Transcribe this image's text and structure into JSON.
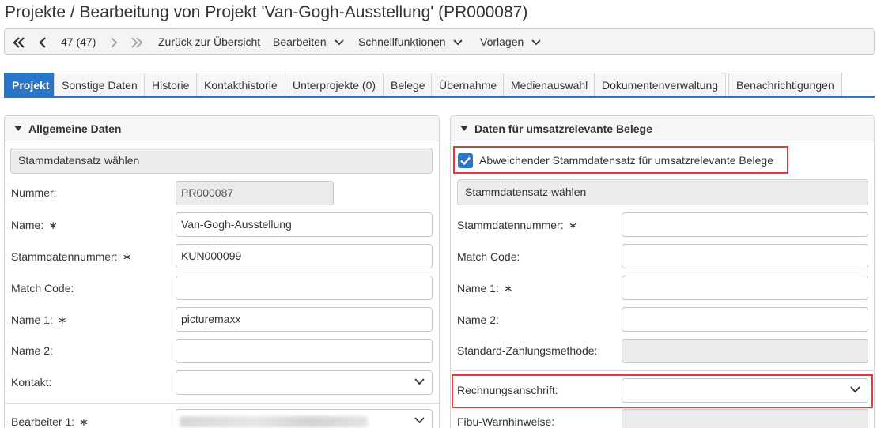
{
  "page": {
    "title": "Projekte / Bearbeitung von Projekt 'Van-Gogh-Ausstellung' (PR000087)"
  },
  "toolbar": {
    "record_counter": "47 (47)",
    "back_to_overview": "Zurück zur Übersicht",
    "edit": "Bearbeiten",
    "quick_functions": "Schnellfunktionen",
    "templates": "Vorlagen"
  },
  "tabs": [
    {
      "label": "Projekt",
      "active": true
    },
    {
      "label": "Sonstige Daten"
    },
    {
      "label": "Historie"
    },
    {
      "label": "Kontakthistorie"
    },
    {
      "label": "Unterprojekte (0)"
    },
    {
      "label": "Belege"
    },
    {
      "label": "Übernahme"
    },
    {
      "label": "Medienauswahl"
    },
    {
      "label": "Dokumentenverwaltung"
    },
    {
      "label": "Benachrichtigungen"
    }
  ],
  "left_panel": {
    "title": "Allgemeine Daten",
    "select_master_button": "Stammdatensatz wählen",
    "fields": {
      "nummer": {
        "label": "Nummer:",
        "value": "PR000087"
      },
      "name": {
        "label": "Name:",
        "required": "∗",
        "value": "Van-Gogh-Ausstellung"
      },
      "stammdatennummer": {
        "label": "Stammdatennummer:",
        "required": "∗",
        "value": "KUN000099"
      },
      "match_code": {
        "label": "Match Code:",
        "value": ""
      },
      "name1": {
        "label": "Name 1:",
        "required": "∗",
        "value": "picturemaxx"
      },
      "name2": {
        "label": "Name 2:",
        "value": ""
      },
      "kontakt": {
        "label": "Kontakt:",
        "value": ""
      },
      "bearbeiter1": {
        "label": "Bearbeiter 1:",
        "required": "∗"
      }
    }
  },
  "right_panel": {
    "title": "Daten für umsatzrelevante Belege",
    "checkbox_label": "Abweichender Stammdatensatz für umsatzrelevante Belege",
    "checkbox_checked": true,
    "select_master_button": "Stammdatensatz wählen",
    "fields": {
      "stammdatennummer": {
        "label": "Stammdatennummer:",
        "required": "∗",
        "value": ""
      },
      "match_code": {
        "label": "Match Code:",
        "value": ""
      },
      "name1": {
        "label": "Name 1:",
        "required": "∗",
        "value": ""
      },
      "name2": {
        "label": "Name 2:",
        "value": ""
      },
      "zahlungsmethode": {
        "label": "Standard-Zahlungsmethode:",
        "value": ""
      },
      "rechnungsanschrift": {
        "label": "Rechnungsanschrift:",
        "value": ""
      },
      "fibu": {
        "label": "Fibu-Warnhinweise:"
      }
    }
  },
  "colors": {
    "accent": "#2a75c7",
    "highlight": "#e0393e"
  },
  "icons": [
    "first-page-icon",
    "prev-icon",
    "next-icon",
    "last-page-icon",
    "chevron-down-icon",
    "collapse-triangle-icon",
    "checkmark-icon"
  ]
}
